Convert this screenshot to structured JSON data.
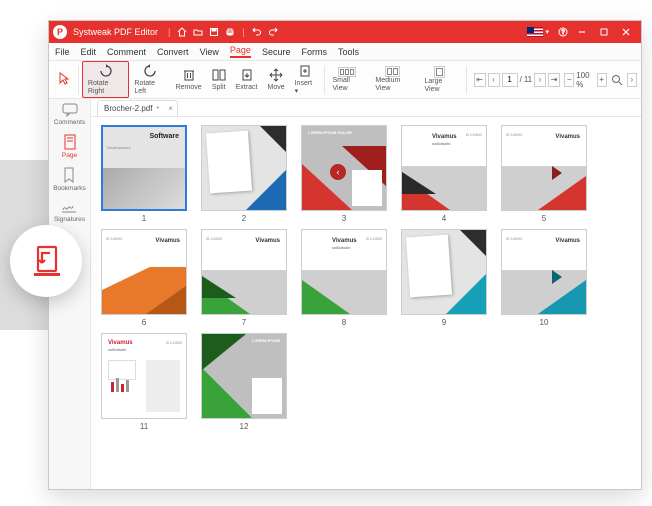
{
  "titlebar": {
    "app_name": "Systweak PDF Editor",
    "lang": "US"
  },
  "menu": [
    "File",
    "Edit",
    "Comment",
    "Convert",
    "View",
    "Page",
    "Secure",
    "Forms",
    "Tools"
  ],
  "menu_active_index": 5,
  "ribbon": {
    "tools": [
      "",
      "Rotate Right",
      "Rotate Left",
      "Remove",
      "Split",
      "Extract",
      "Move",
      "Insert"
    ],
    "views": [
      "Small View",
      "Medium View",
      "Large View"
    ],
    "page_input": "1",
    "page_total": "11",
    "zoom": "100 %"
  },
  "sidebar": [
    "Comments",
    "Page",
    "Bookmarks",
    "Signatures"
  ],
  "sidebar_active_index": 1,
  "tab": {
    "filename": "Brocher-2.pdf"
  },
  "thumbs": [
    1,
    2,
    3,
    4,
    5,
    6,
    7,
    8,
    9,
    10,
    11,
    12
  ]
}
